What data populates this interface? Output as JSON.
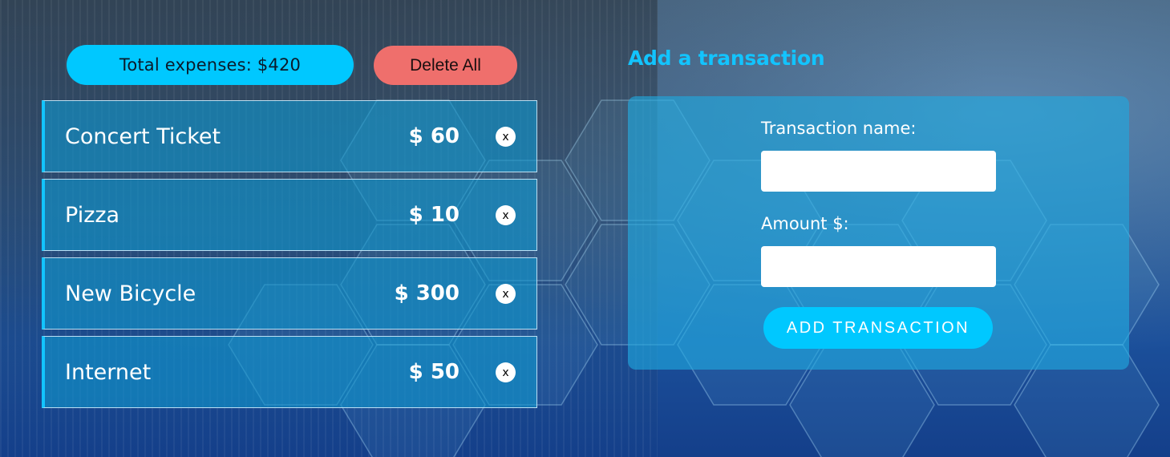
{
  "summary": {
    "total_label": "Total expenses: $420",
    "delete_all_label": "Delete All"
  },
  "transactions": [
    {
      "name": "Concert Ticket",
      "amount": "$ 60",
      "close": "x"
    },
    {
      "name": "Pizza",
      "amount": "$ 10",
      "close": "x"
    },
    {
      "name": "New Bicycle",
      "amount": "$ 300",
      "close": "x"
    },
    {
      "name": "Internet",
      "amount": "$ 50",
      "close": "x"
    }
  ],
  "form": {
    "title": "Add a transaction",
    "name_label": "Transaction name:",
    "name_value": "",
    "amount_label": "Amount $:",
    "amount_value": "",
    "submit_label": "ADD TRANSACTION"
  },
  "colors": {
    "accent": "#00c8ff",
    "danger": "#ef6f6c",
    "item_border": "#12c4ff"
  }
}
